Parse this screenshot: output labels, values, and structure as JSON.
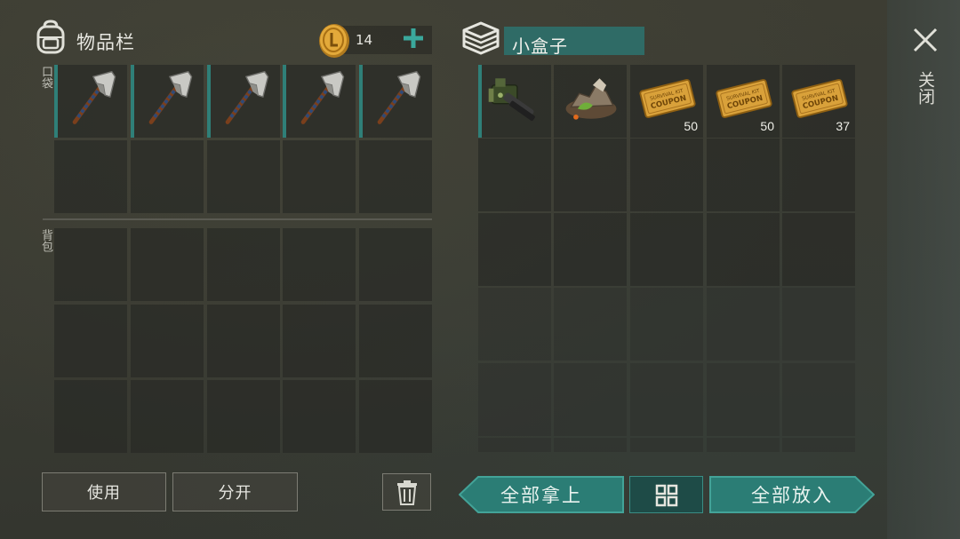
{
  "inventory": {
    "title": "物品栏",
    "icon": "backpack-icon",
    "pocket_label": "口袋",
    "backpack_label": "背包",
    "coins": "14",
    "pocket_items": [
      {
        "name": "pickaxe",
        "qty": ""
      },
      {
        "name": "pickaxe",
        "qty": ""
      },
      {
        "name": "pickaxe",
        "qty": ""
      },
      {
        "name": "pickaxe",
        "qty": ""
      },
      {
        "name": "pickaxe",
        "qty": ""
      }
    ]
  },
  "container": {
    "title": "小盒子",
    "icon": "box-icon",
    "items": [
      {
        "name": "minigun",
        "qty": ""
      },
      {
        "name": "stone-pile",
        "qty": ""
      },
      {
        "name": "survival-kit-coupon",
        "qty": "50"
      },
      {
        "name": "survival-kit-coupon",
        "qty": "50"
      },
      {
        "name": "survival-kit-coupon",
        "qty": "37"
      }
    ]
  },
  "close": {
    "label": "关闭"
  },
  "buttons": {
    "use": "使用",
    "split": "分开",
    "take_all": "全部拿上",
    "put_all": "全部放入"
  },
  "colors": {
    "teal": "#2f7f78",
    "teal_dark": "#1e4b47",
    "slot": "#2a2c26"
  }
}
